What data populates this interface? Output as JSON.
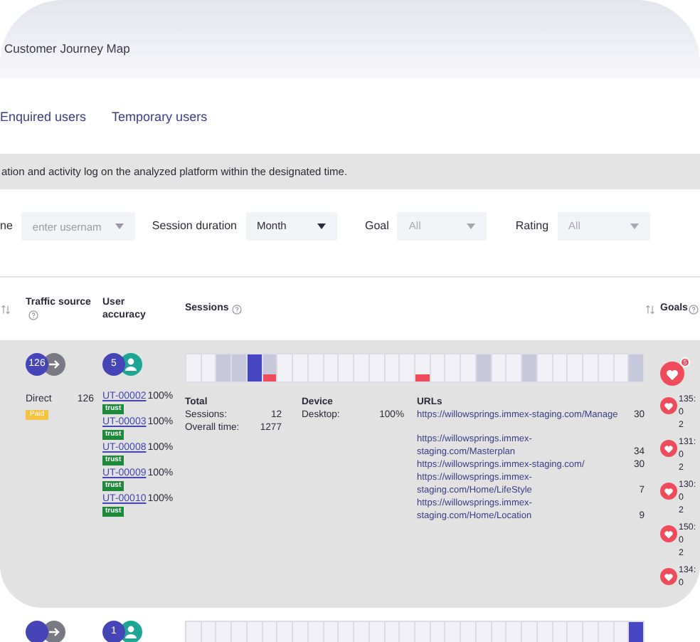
{
  "header": {
    "title": "Customer Journey Map"
  },
  "tabs": [
    {
      "label": "Enquired users",
      "selected": false
    },
    {
      "label": "Temporary users",
      "selected": false
    }
  ],
  "banner": "ation and activity log on the analyzed platform within the designated time.",
  "filters": [
    {
      "label": "ne",
      "kind": "input",
      "placeholder": "enter usernam"
    },
    {
      "label": "Session duration",
      "kind": "select",
      "value": "Month"
    },
    {
      "label": "Goal",
      "kind": "select",
      "placeholder": "All"
    },
    {
      "label": "Rating",
      "kind": "select",
      "placeholder": "All"
    }
  ],
  "columns": {
    "traffic": "Traffic source",
    "users": "User accuracy",
    "sessions": "Sessions",
    "goals": "Goals"
  },
  "rows": [
    {
      "traffic": {
        "count": "126",
        "source": "Direct",
        "visits": "126",
        "tag": "Paid"
      },
      "users_count": "5",
      "users": [
        {
          "id": "UT-00002",
          "accuracy": "100%",
          "tag": "trust"
        },
        {
          "id": "UT-00003",
          "accuracy": "100%",
          "tag": "trust"
        },
        {
          "id": "UT-00008",
          "accuracy": "100%",
          "tag": "trust"
        },
        {
          "id": "UT-00009",
          "accuracy": "100%",
          "tag": "trust"
        },
        {
          "id": "UT-00010",
          "accuracy": "100%",
          "tag": "trust"
        }
      ],
      "cells": [
        {
          "kind": "empty",
          "alert": false
        },
        {
          "kind": "empty",
          "alert": false
        },
        {
          "kind": "visited",
          "alert": false
        },
        {
          "kind": "visited",
          "alert": false
        },
        {
          "kind": "current",
          "alert": false
        },
        {
          "kind": "visited",
          "alert": true
        },
        {
          "kind": "empty",
          "alert": false
        },
        {
          "kind": "empty",
          "alert": false
        },
        {
          "kind": "empty",
          "alert": false
        },
        {
          "kind": "empty",
          "alert": false
        },
        {
          "kind": "empty",
          "alert": false
        },
        {
          "kind": "empty",
          "alert": false
        },
        {
          "kind": "empty",
          "alert": false
        },
        {
          "kind": "empty",
          "alert": false
        },
        {
          "kind": "empty",
          "alert": false
        },
        {
          "kind": "empty",
          "alert": true
        },
        {
          "kind": "empty",
          "alert": false
        },
        {
          "kind": "empty",
          "alert": false
        },
        {
          "kind": "empty",
          "alert": false
        },
        {
          "kind": "visited",
          "alert": false
        },
        {
          "kind": "empty",
          "alert": false
        },
        {
          "kind": "empty",
          "alert": false
        },
        {
          "kind": "visited",
          "alert": false
        },
        {
          "kind": "empty",
          "alert": false
        },
        {
          "kind": "empty",
          "alert": false
        },
        {
          "kind": "empty",
          "alert": false
        },
        {
          "kind": "empty",
          "alert": false
        },
        {
          "kind": "empty",
          "alert": false
        },
        {
          "kind": "empty",
          "alert": false
        },
        {
          "kind": "visited",
          "alert": false
        }
      ],
      "total": {
        "title": "Total",
        "sessions_label": "Sessions:",
        "sessions": "12",
        "time_label": "Overall time:",
        "time": "1277"
      },
      "device": {
        "title": "Device",
        "label": "Desktop:",
        "value": "100%"
      },
      "urls_title": "URLs",
      "urls": [
        {
          "url": "https://willowsprings.immex-staging.com/Manage",
          "count": "30"
        },
        {
          "url": "https://willowsprings.immex-staging.com/Masterplan",
          "count": "34"
        },
        {
          "url": "https://willowsprings.immex-staging.com/",
          "count": "30"
        },
        {
          "url": "https://willowsprings.immex-staging.com/Home/LifeStyle",
          "count": "7"
        },
        {
          "url": "https://willowsprings.immex-staging.com/Home/Location",
          "count": "9"
        }
      ],
      "goals_badge": "5",
      "goals": [
        {
          "lines": [
            "135:",
            "0",
            "2"
          ]
        },
        {
          "lines": [
            "131:",
            "0",
            "2"
          ]
        },
        {
          "lines": [
            "130:",
            "0",
            "2"
          ]
        },
        {
          "lines": [
            "150:",
            "0",
            "2"
          ]
        },
        {
          "lines": [
            "134:",
            "0"
          ]
        }
      ]
    },
    {
      "users_count": "1",
      "cells": [
        {
          "kind": "empty"
        },
        {
          "kind": "empty"
        },
        {
          "kind": "empty"
        },
        {
          "kind": "empty"
        },
        {
          "kind": "empty"
        },
        {
          "kind": "empty"
        },
        {
          "kind": "empty"
        },
        {
          "kind": "empty"
        },
        {
          "kind": "empty"
        },
        {
          "kind": "empty"
        },
        {
          "kind": "empty"
        },
        {
          "kind": "empty"
        },
        {
          "kind": "empty"
        },
        {
          "kind": "empty"
        },
        {
          "kind": "empty"
        },
        {
          "kind": "empty"
        },
        {
          "kind": "empty"
        },
        {
          "kind": "empty"
        },
        {
          "kind": "empty"
        },
        {
          "kind": "empty"
        },
        {
          "kind": "empty"
        },
        {
          "kind": "empty"
        },
        {
          "kind": "empty"
        },
        {
          "kind": "empty"
        },
        {
          "kind": "empty"
        },
        {
          "kind": "empty"
        },
        {
          "kind": "empty"
        },
        {
          "kind": "empty"
        },
        {
          "kind": "empty"
        },
        {
          "kind": "current"
        }
      ]
    }
  ]
}
